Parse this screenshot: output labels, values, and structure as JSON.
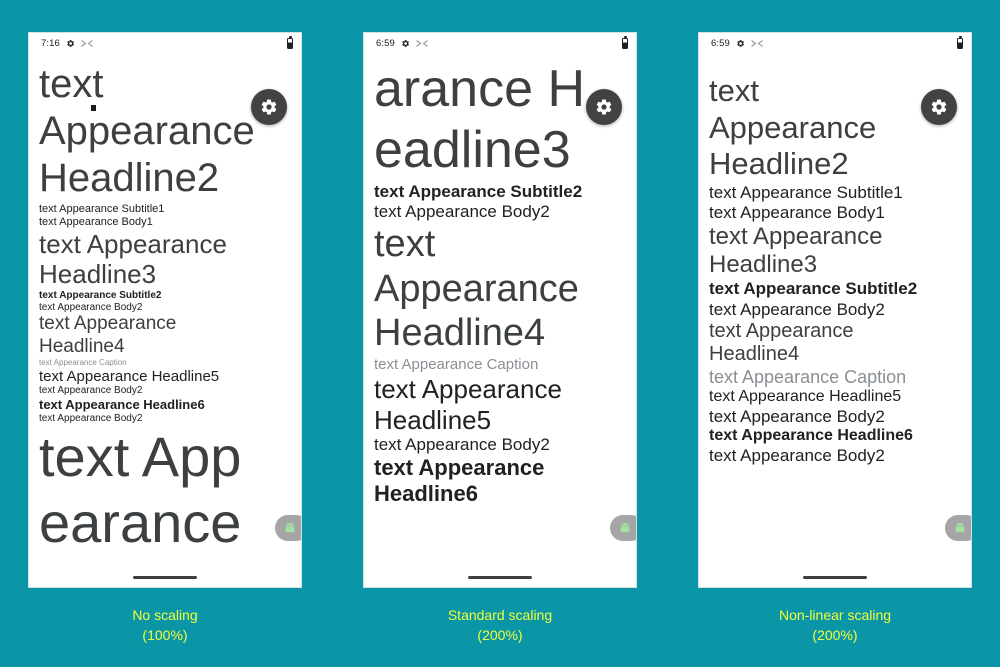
{
  "background_color": "#0b96a8",
  "caption_color": "#f2ff3a",
  "fab_color": "#424242",
  "phones": [
    {
      "id": "phone-1",
      "status": {
        "time": "7:16",
        "icon_gear": "gear-icon",
        "icon_secondary": "network-icon",
        "battery": "battery-icon"
      },
      "fab": {
        "icon": "settings-gear-icon"
      },
      "side_tab": {
        "icon": "android-robot-icon"
      },
      "caption": {
        "line1": "No scaling",
        "line2": "(100%)"
      },
      "lines": [
        {
          "text": "text",
          "size": 40,
          "color": "mid",
          "weight": "normal"
        },
        {
          "text": "Appearance",
          "size": 40,
          "color": "mid",
          "weight": "normal"
        },
        {
          "text": "Headline2",
          "size": 40,
          "color": "mid",
          "weight": "normal"
        },
        {
          "text": "text Appearance Subtitle1",
          "size": 11,
          "color": "dark",
          "weight": "normal"
        },
        {
          "text": "text Appearance Body1",
          "size": 11,
          "color": "dark",
          "weight": "normal"
        },
        {
          "text": "text Appearance",
          "size": 26,
          "color": "mid",
          "weight": "normal"
        },
        {
          "text": "Headline3",
          "size": 26,
          "color": "mid",
          "weight": "normal"
        },
        {
          "text": "text Appearance Subtitle2",
          "size": 10,
          "color": "dark",
          "weight": "bold"
        },
        {
          "text": "text Appearance Body2",
          "size": 10,
          "color": "dark",
          "weight": "normal"
        },
        {
          "text": "text Appearance",
          "size": 19,
          "color": "mid",
          "weight": "normal"
        },
        {
          "text": "Headline4",
          "size": 19,
          "color": "mid",
          "weight": "normal"
        },
        {
          "text": "text Appearance Caption",
          "size": 8,
          "color": "light",
          "weight": "normal"
        },
        {
          "text": "text Appearance Headline5",
          "size": 15,
          "color": "dark",
          "weight": "normal"
        },
        {
          "text": "text Appearance Body2",
          "size": 10,
          "color": "dark",
          "weight": "normal"
        },
        {
          "text": "text Appearance Headline6",
          "size": 13,
          "color": "dark",
          "weight": "bold"
        },
        {
          "text": "text Appearance Body2",
          "size": 10,
          "color": "dark",
          "weight": "normal"
        },
        {
          "text": "text App",
          "size": 56,
          "color": "mid",
          "weight": "normal"
        },
        {
          "text": "earance",
          "size": 56,
          "color": "mid",
          "weight": "normal"
        }
      ]
    },
    {
      "id": "phone-2",
      "status": {
        "time": "6:59",
        "icon_gear": "gear-icon",
        "icon_secondary": "network-icon",
        "battery": "battery-icon"
      },
      "fab": {
        "icon": "settings-gear-icon"
      },
      "side_tab": {
        "icon": "android-robot-icon"
      },
      "caption": {
        "line1": "Standard scaling",
        "line2": "(200%)"
      },
      "lines": [
        {
          "text": "arance H",
          "size": 52,
          "color": "mid",
          "weight": "normal"
        },
        {
          "text": "eadline3",
          "size": 52,
          "color": "mid",
          "weight": "normal"
        },
        {
          "text": "text Appearance Subtitle2",
          "size": 17,
          "color": "dark",
          "weight": "bold"
        },
        {
          "text": "text Appearance Body2",
          "size": 17,
          "color": "dark",
          "weight": "normal"
        },
        {
          "text": "text",
          "size": 38,
          "color": "mid",
          "weight": "normal"
        },
        {
          "text": "Appearance",
          "size": 38,
          "color": "mid",
          "weight": "normal"
        },
        {
          "text": "Headline4",
          "size": 38,
          "color": "mid",
          "weight": "normal"
        },
        {
          "text": "text Appearance Caption",
          "size": 15,
          "color": "light",
          "weight": "normal"
        },
        {
          "text": "text Appearance",
          "size": 26,
          "color": "dark",
          "weight": "normal"
        },
        {
          "text": "Headline5",
          "size": 26,
          "color": "dark",
          "weight": "normal"
        },
        {
          "text": "text Appearance Body2",
          "size": 17,
          "color": "dark",
          "weight": "normal"
        },
        {
          "text": "text Appearance",
          "size": 22,
          "color": "dark",
          "weight": "bold"
        },
        {
          "text": "Headline6",
          "size": 22,
          "color": "dark",
          "weight": "bold"
        }
      ]
    },
    {
      "id": "phone-3",
      "status": {
        "time": "6:59",
        "icon_gear": "gear-icon",
        "icon_secondary": "network-icon",
        "battery": "battery-icon"
      },
      "fab": {
        "icon": "settings-gear-icon"
      },
      "side_tab": {
        "icon": "android-robot-icon"
      },
      "caption": {
        "line1": "Non-linear scaling",
        "line2": "(200%)"
      },
      "lines": [
        {
          "text": "text",
          "size": 31,
          "color": "mid",
          "weight": "normal"
        },
        {
          "text": "Appearance",
          "size": 31,
          "color": "mid",
          "weight": "normal"
        },
        {
          "text": "Headline2",
          "size": 31,
          "color": "mid",
          "weight": "normal"
        },
        {
          "text": "text Appearance Subtitle1",
          "size": 17,
          "color": "dark",
          "weight": "normal"
        },
        {
          "text": "text Appearance Body1",
          "size": 17,
          "color": "dark",
          "weight": "normal"
        },
        {
          "text": "text Appearance",
          "size": 24,
          "color": "mid",
          "weight": "normal"
        },
        {
          "text": "Headline3",
          "size": 24,
          "color": "mid",
          "weight": "normal"
        },
        {
          "text": "text Appearance Subtitle2",
          "size": 17,
          "color": "dark",
          "weight": "bold"
        },
        {
          "text": "text Appearance Body2",
          "size": 17,
          "color": "dark",
          "weight": "normal"
        },
        {
          "text": "text Appearance",
          "size": 20,
          "color": "mid",
          "weight": "normal"
        },
        {
          "text": "Headline4",
          "size": 20,
          "color": "mid",
          "weight": "normal"
        },
        {
          "text": "text Appearance Caption",
          "size": 18,
          "color": "light",
          "weight": "normal"
        },
        {
          "text": "text Appearance Headline5",
          "size": 16,
          "color": "dark",
          "weight": "normal"
        },
        {
          "text": "text Appearance Body2",
          "size": 17,
          "color": "dark",
          "weight": "normal"
        },
        {
          "text": "text Appearance Headline6",
          "size": 16,
          "color": "dark",
          "weight": "bold"
        },
        {
          "text": "text Appearance Body2",
          "size": 17,
          "color": "dark",
          "weight": "normal"
        }
      ]
    }
  ]
}
